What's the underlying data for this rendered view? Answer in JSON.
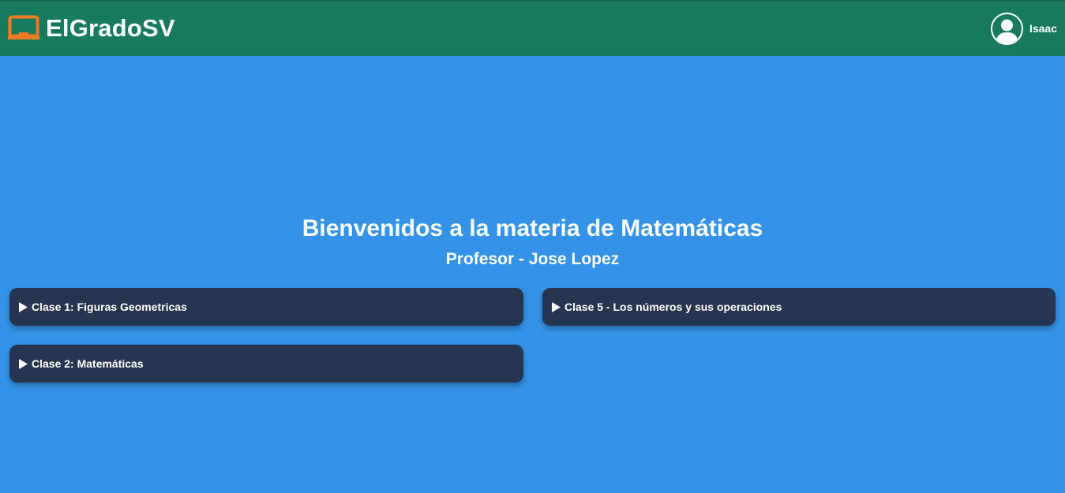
{
  "header": {
    "brand_name": "ElGradoSV",
    "brand_icon": "classroom-board-icon",
    "user_name": "Isaac",
    "avatar_icon": "user-avatar-icon"
  },
  "hero": {
    "title": "Bienvenidos a la materia de Matemáticas",
    "subtitle": "Profesor - Jose Lopez"
  },
  "classes": [
    {
      "label": "Clase 1: Figuras Geometricas"
    },
    {
      "label": "Clase 5 - Los números y sus operaciones"
    },
    {
      "label": "Clase 2: Matemáticas"
    }
  ],
  "colors": {
    "header_bg": "#177a5f",
    "page_bg": "#3493e8",
    "card_bg": "#263550",
    "brand_icon": "#f47a20"
  }
}
